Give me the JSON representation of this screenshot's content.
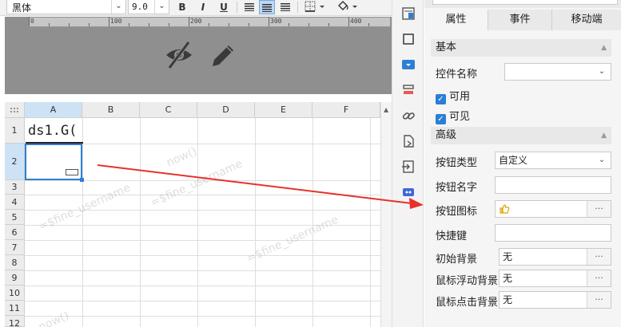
{
  "toolbar": {
    "font_name": "黑体",
    "font_size": "9.0",
    "bold": "B",
    "italic": "I",
    "underline": "U"
  },
  "ruler": {
    "labels": [
      "0",
      "100",
      "200",
      "300",
      "400"
    ]
  },
  "sheet": {
    "columns": [
      "A",
      "B",
      "C",
      "D",
      "E",
      "F"
    ],
    "rows": [
      "1",
      "2",
      "3",
      "4",
      "5",
      "6",
      "7",
      "8",
      "9",
      "10",
      "11",
      "12"
    ],
    "cell_a1": "ds1.G(",
    "watermarks": [
      "=$fine_username",
      "=$fine_username",
      "now()",
      "=$fine_username",
      "now()"
    ]
  },
  "panel": {
    "tabs": [
      "属性",
      "事件",
      "移动端"
    ],
    "section_basic": "基本",
    "control_name_label": "控件名称",
    "control_name_value": "",
    "enabled_label": "可用",
    "visible_label": "可见",
    "section_advanced": "高级",
    "button_type_label": "按钮类型",
    "button_type_value": "自定义",
    "button_name_label": "按钮名字",
    "button_name_value": "",
    "button_icon_label": "按钮图标",
    "shortcut_label": "快捷键",
    "shortcut_value": "",
    "init_bg_label": "初始背景",
    "init_bg_value": "无",
    "hover_bg_label": "鼠标浮动背景",
    "hover_bg_value": "无",
    "click_bg_label": "鼠标点击背景",
    "click_bg_value": "无",
    "dots": "···"
  },
  "colors": {
    "accent": "#2d7fd3",
    "arrow": "#e8312a"
  }
}
